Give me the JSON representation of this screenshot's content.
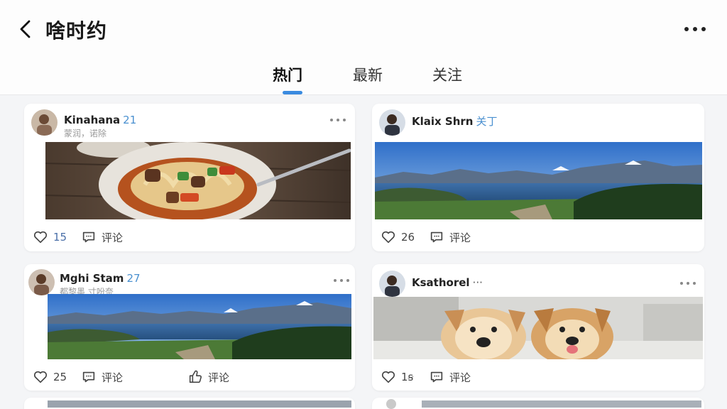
{
  "header": {
    "title": "啥时约"
  },
  "tabs": [
    {
      "label": "热门"
    },
    {
      "label": "最新"
    },
    {
      "label": "关注"
    }
  ],
  "colors": {
    "accent": "#3a8be0",
    "badge": "#4a90d0"
  },
  "posts": [
    {
      "user": "Kinahana",
      "badge": "21",
      "subtitle": "蒙润，诺除",
      "image": "pasta-dish",
      "likes": "15",
      "comment_label": "评论"
    },
    {
      "user": "Klaix Shrn",
      "badge": "关丁",
      "subtitle": "",
      "image": "mountain-lake",
      "likes": "26",
      "comment_label": "评论"
    },
    {
      "user": "Mghi Stam",
      "badge": "27",
      "subtitle": "都黎墨  寸吩奈",
      "image": "mountain-lake",
      "likes": "25",
      "comment_label": "评论",
      "extra_label": "评论"
    },
    {
      "user": "Ksathorel",
      "badge": "···",
      "subtitle": "",
      "image": "two-dogs",
      "likes": "1ꞩ",
      "comment_label": "评论"
    }
  ]
}
